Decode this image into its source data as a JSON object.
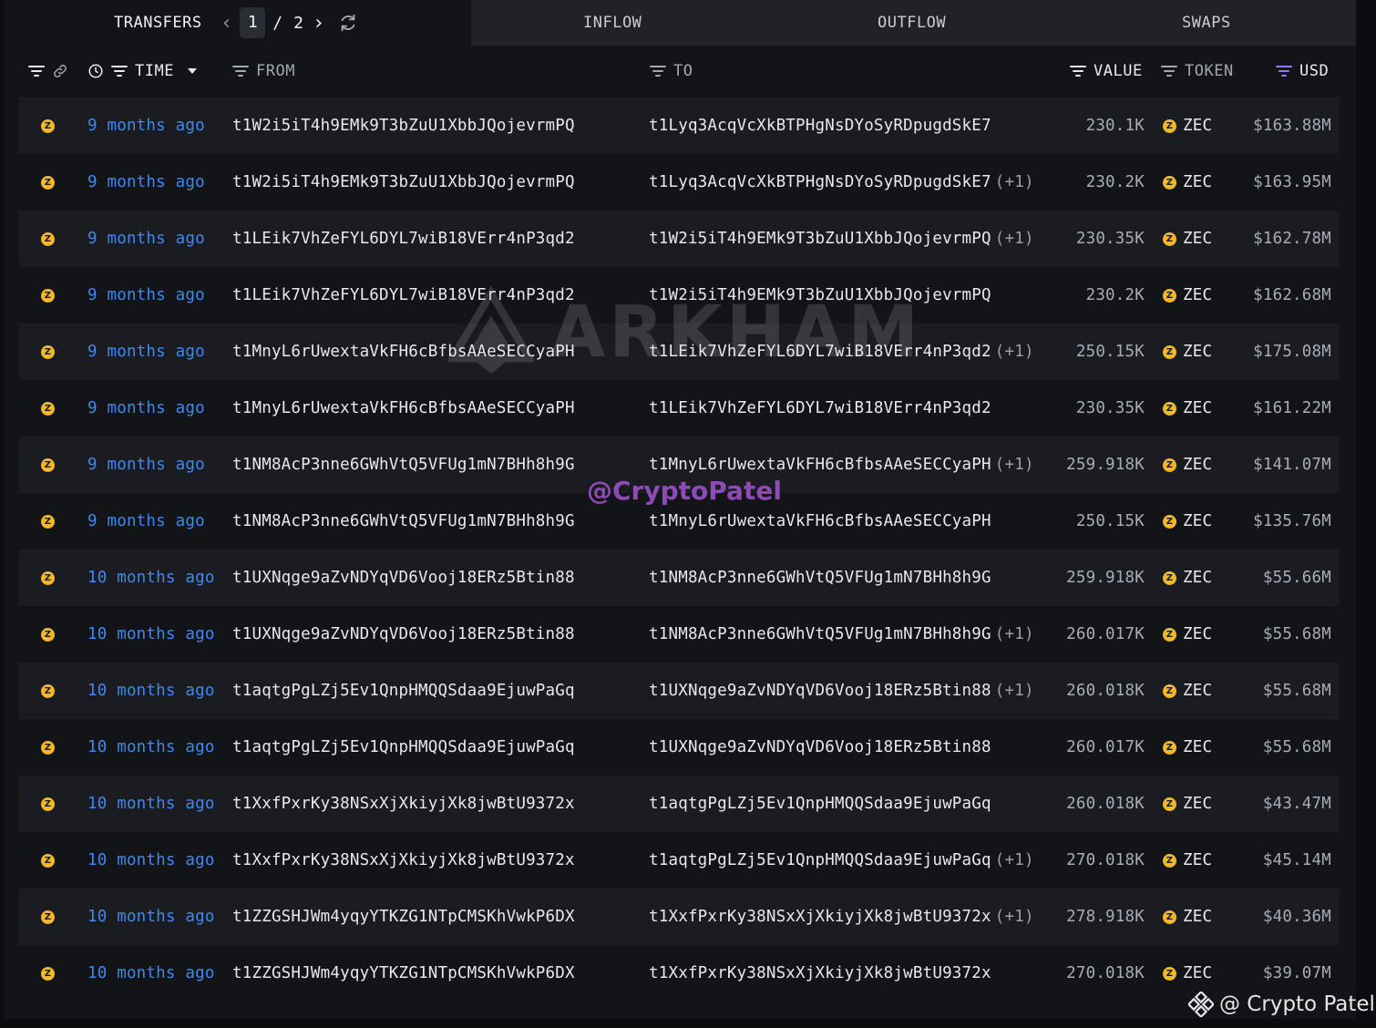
{
  "tabs": {
    "transfers": "TRANSFERS",
    "inflow": "INFLOW",
    "outflow": "OUTFLOW",
    "swaps": "SWAPS"
  },
  "pagination": {
    "current": "1",
    "separator": "/",
    "total": "2"
  },
  "columns": {
    "time": "TIME",
    "from": "FROM",
    "to": "TO",
    "value": "VALUE",
    "token": "TOKEN",
    "usd": "USD"
  },
  "rows": [
    {
      "time": "9 months ago",
      "from": "t1W2i5iT4h9EMk9T3bZuU1XbbJQojevrmPQ",
      "to": "t1Lyq3AcqVcXkBTPHgNsDYoSyRDpugdSkE7",
      "to_extra": "",
      "value": "230.1K",
      "token": "ZEC",
      "usd": "$163.88M"
    },
    {
      "time": "9 months ago",
      "from": "t1W2i5iT4h9EMk9T3bZuU1XbbJQojevrmPQ",
      "to": "t1Lyq3AcqVcXkBTPHgNsDYoSyRDpugdSkE7",
      "to_extra": "(+1)",
      "value": "230.2K",
      "token": "ZEC",
      "usd": "$163.95M"
    },
    {
      "time": "9 months ago",
      "from": "t1LEik7VhZeFYL6DYL7wiB18VErr4nP3qd2",
      "to": "t1W2i5iT4h9EMk9T3bZuU1XbbJQojevrmPQ",
      "to_extra": "(+1)",
      "value": "230.35K",
      "token": "ZEC",
      "usd": "$162.78M"
    },
    {
      "time": "9 months ago",
      "from": "t1LEik7VhZeFYL6DYL7wiB18VErr4nP3qd2",
      "to": "t1W2i5iT4h9EMk9T3bZuU1XbbJQojevrmPQ",
      "to_extra": "",
      "value": "230.2K",
      "token": "ZEC",
      "usd": "$162.68M"
    },
    {
      "time": "9 months ago",
      "from": "t1MnyL6rUwextaVkFH6cBfbsAAeSECCyaPH",
      "to": "t1LEik7VhZeFYL6DYL7wiB18VErr4nP3qd2",
      "to_extra": "(+1)",
      "value": "250.15K",
      "token": "ZEC",
      "usd": "$175.08M"
    },
    {
      "time": "9 months ago",
      "from": "t1MnyL6rUwextaVkFH6cBfbsAAeSECCyaPH",
      "to": "t1LEik7VhZeFYL6DYL7wiB18VErr4nP3qd2",
      "to_extra": "",
      "value": "230.35K",
      "token": "ZEC",
      "usd": "$161.22M"
    },
    {
      "time": "9 months ago",
      "from": "t1NM8AcP3nne6GWhVtQ5VFUg1mN7BHh8h9G",
      "to": "t1MnyL6rUwextaVkFH6cBfbsAAeSECCyaPH",
      "to_extra": "(+1)",
      "value": "259.918K",
      "token": "ZEC",
      "usd": "$141.07M"
    },
    {
      "time": "9 months ago",
      "from": "t1NM8AcP3nne6GWhVtQ5VFUg1mN7BHh8h9G",
      "to": "t1MnyL6rUwextaVkFH6cBfbsAAeSECCyaPH",
      "to_extra": "",
      "value": "250.15K",
      "token": "ZEC",
      "usd": "$135.76M"
    },
    {
      "time": "10 months ago",
      "from": "t1UXNqge9aZvNDYqVD6Vooj18ERz5Btin88",
      "to": "t1NM8AcP3nne6GWhVtQ5VFUg1mN7BHh8h9G",
      "to_extra": "",
      "value": "259.918K",
      "token": "ZEC",
      "usd": "$55.66M"
    },
    {
      "time": "10 months ago",
      "from": "t1UXNqge9aZvNDYqVD6Vooj18ERz5Btin88",
      "to": "t1NM8AcP3nne6GWhVtQ5VFUg1mN7BHh8h9G",
      "to_extra": "(+1)",
      "value": "260.017K",
      "token": "ZEC",
      "usd": "$55.68M"
    },
    {
      "time": "10 months ago",
      "from": "t1aqtgPgLZj5Ev1QnpHMQQSdaa9EjuwPaGq",
      "to": "t1UXNqge9aZvNDYqVD6Vooj18ERz5Btin88",
      "to_extra": "(+1)",
      "value": "260.018K",
      "token": "ZEC",
      "usd": "$55.68M"
    },
    {
      "time": "10 months ago",
      "from": "t1aqtgPgLZj5Ev1QnpHMQQSdaa9EjuwPaGq",
      "to": "t1UXNqge9aZvNDYqVD6Vooj18ERz5Btin88",
      "to_extra": "",
      "value": "260.017K",
      "token": "ZEC",
      "usd": "$55.68M"
    },
    {
      "time": "10 months ago",
      "from": "t1XxfPxrKy38NSxXjXkiyjXk8jwBtU9372x",
      "to": "t1aqtgPgLZj5Ev1QnpHMQQSdaa9EjuwPaGq",
      "to_extra": "",
      "value": "260.018K",
      "token": "ZEC",
      "usd": "$43.47M"
    },
    {
      "time": "10 months ago",
      "from": "t1XxfPxrKy38NSxXjXkiyjXk8jwBtU9372x",
      "to": "t1aqtgPgLZj5Ev1QnpHMQQSdaa9EjuwPaGq",
      "to_extra": "(+1)",
      "value": "270.018K",
      "token": "ZEC",
      "usd": "$45.14M"
    },
    {
      "time": "10 months ago",
      "from": "t1ZZGSHJWm4yqyYTKZG1NTpCMSKhVwkP6DX",
      "to": "t1XxfPxrKy38NSxXjXkiyjXk8jwBtU9372x",
      "to_extra": "(+1)",
      "value": "278.918K",
      "token": "ZEC",
      "usd": "$40.36M"
    },
    {
      "time": "10 months ago",
      "from": "t1ZZGSHJWm4yqyYTKZG1NTpCMSKhVwkP6DX",
      "to": "t1XxfPxrKy38NSxXjXkiyjXk8jwBtU9372x",
      "to_extra": "",
      "value": "270.018K",
      "token": "ZEC",
      "usd": "$39.07M"
    }
  ],
  "watermarks": {
    "arkham": "ARKHAM",
    "handle": "@CryptoPatel",
    "footer": "@ Crypto Patel"
  },
  "colors": {
    "time_link": "#3f88f0",
    "zec_coin": "#f4b728",
    "usd_filter_active": "#8b7cf6",
    "handle_watermark": "#9b4fc7"
  }
}
